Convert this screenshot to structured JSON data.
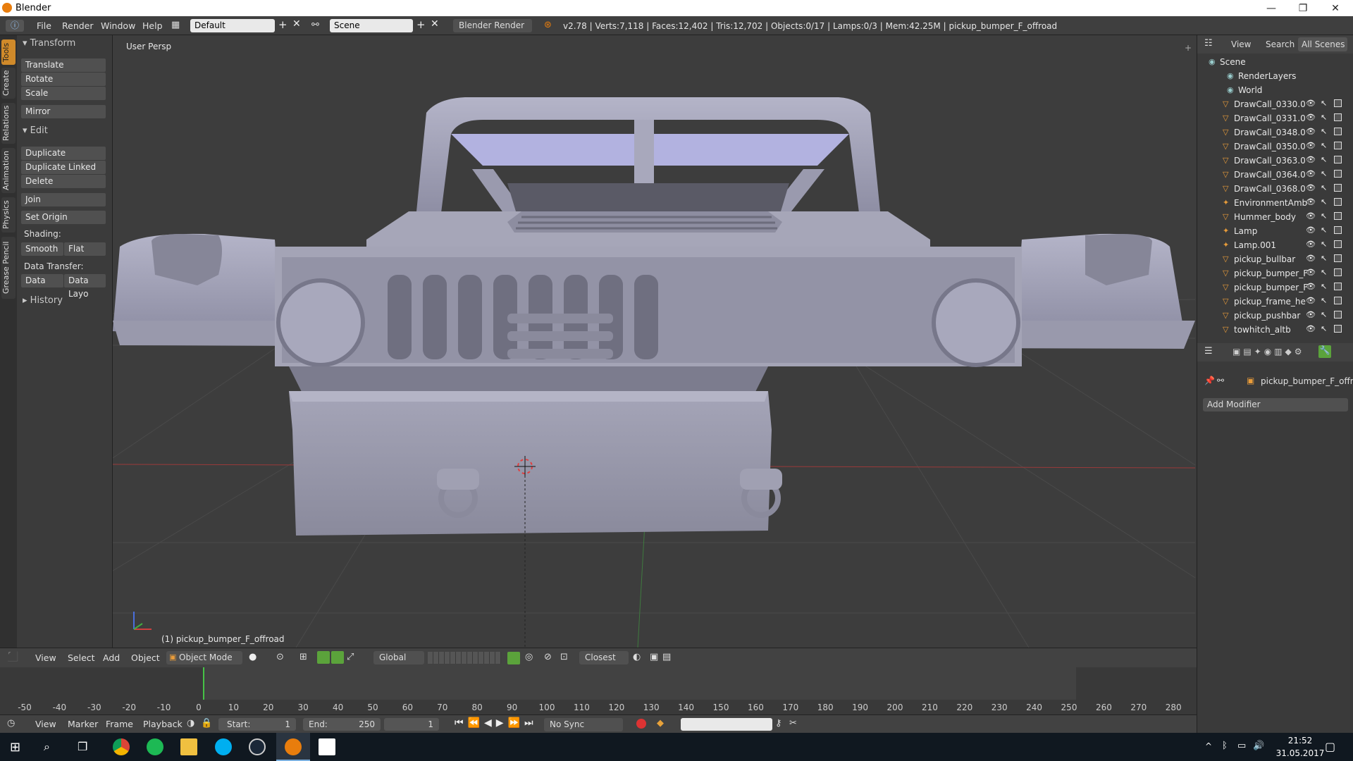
{
  "window": {
    "title": "Blender",
    "controls": [
      "—",
      "❐",
      "✕"
    ]
  },
  "info_header": {
    "menus": [
      "File",
      "Render",
      "Window",
      "Help"
    ],
    "layout": "Default",
    "scene": "Scene",
    "engine": "Blender Render",
    "stats": "v2.78 | Verts:7,118 | Faces:12,402 | Tris:12,702 | Objects:0/17 | Lamps:0/3 | Mem:42.25M | pickup_bumper_F_offroad"
  },
  "tool_tabs": [
    "Tools",
    "Create",
    "Relations",
    "Animation",
    "Physics",
    "Grease Pencil"
  ],
  "toolshelf": {
    "transform_title": "Transform",
    "translate": "Translate",
    "rotate": "Rotate",
    "scale": "Scale",
    "mirror": "Mirror",
    "edit_title": "Edit",
    "duplicate": "Duplicate",
    "duplicate_linked": "Duplicate Linked",
    "delete": "Delete",
    "join": "Join",
    "set_origin": "Set Origin",
    "shading_label": "Shading:",
    "smooth": "Smooth",
    "flat": "Flat",
    "data_transfer_label": "Data Transfer:",
    "data": "Data",
    "data_layo": "Data Layo",
    "history_title": "History"
  },
  "viewport": {
    "view_label": "User Persp",
    "object_label": "(1) pickup_bumper_F_offroad"
  },
  "outliner": {
    "tabs": {
      "view": "View",
      "search": "Search",
      "all_scenes": "All Scenes"
    },
    "items": [
      "Scene",
      "RenderLayers",
      "World",
      "DrawCall_0330.0",
      "DrawCall_0331.0",
      "DrawCall_0348.0",
      "DrawCall_0350.0",
      "DrawCall_0363.0",
      "DrawCall_0364.0",
      "DrawCall_0368.0",
      "EnvironmentAmb",
      "Hummer_body",
      "Lamp",
      "Lamp.001",
      "pickup_bullbar",
      "pickup_bumper_F",
      "pickup_bumper_F",
      "pickup_frame_he",
      "pickup_pushbar",
      "towhitch_altb"
    ]
  },
  "properties": {
    "object": "pickup_bumper_F_offro...",
    "add_modifier": "Add Modifier"
  },
  "view_header": {
    "menus": [
      "View",
      "Select",
      "Add",
      "Object"
    ],
    "mode": "Object Mode",
    "orientation": "Global",
    "snap": "Closest"
  },
  "timeline": {
    "ticks": [
      "-50",
      "-40",
      "-30",
      "-20",
      "-10",
      "0",
      "10",
      "20",
      "30",
      "40",
      "50",
      "60",
      "70",
      "80",
      "90",
      "100",
      "110",
      "120",
      "130",
      "140",
      "150",
      "160",
      "170",
      "180",
      "190",
      "200",
      "210",
      "220",
      "230",
      "240",
      "250",
      "260",
      "270",
      "280"
    ]
  },
  "timeline_footer": {
    "menus": [
      "View",
      "Marker",
      "Frame",
      "Playback"
    ],
    "start_label": "Start:",
    "start": "1",
    "end_label": "End:",
    "end": "250",
    "current": "1",
    "sync": "No Sync"
  },
  "taskbar": {
    "time": "21:52",
    "date": "31.05.2017"
  },
  "colors": {
    "accent": "#e87d0d",
    "panel": "#3b3b3b",
    "field": "#e9e9e9"
  }
}
